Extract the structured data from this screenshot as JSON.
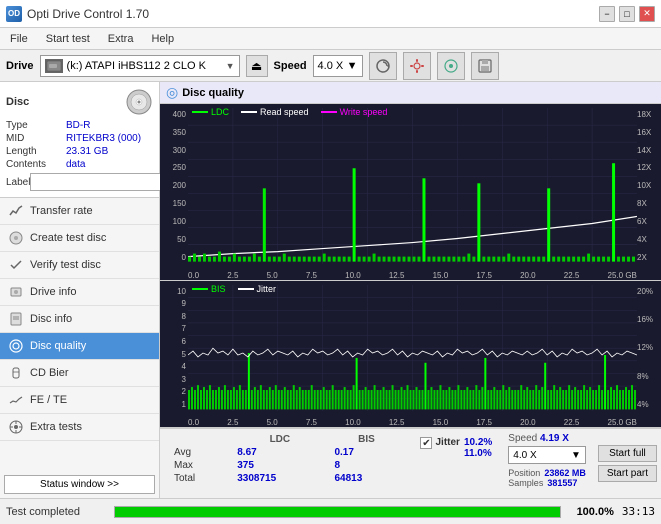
{
  "app": {
    "title": "Opti Drive Control 1.70",
    "icon": "OD"
  },
  "titlebar": {
    "minimize": "−",
    "maximize": "□",
    "close": "✕"
  },
  "menubar": {
    "items": [
      "File",
      "Start test",
      "Extra",
      "Help"
    ]
  },
  "toolbar": {
    "drive_label": "Drive",
    "drive_value": "(k:)  ATAPI iHBS112  2 CLO K",
    "speed_label": "Speed",
    "speed_value": "4.0 X"
  },
  "disc": {
    "title": "Disc",
    "type_label": "Type",
    "type_value": "BD-R",
    "mid_label": "MID",
    "mid_value": "RITEKBR3 (000)",
    "length_label": "Length",
    "length_value": "23.31 GB",
    "contents_label": "Contents",
    "contents_value": "data",
    "label_label": "Label"
  },
  "nav": {
    "items": [
      {
        "id": "transfer-rate",
        "label": "Transfer rate",
        "icon": "📈"
      },
      {
        "id": "create-test-disc",
        "label": "Create test disc",
        "icon": "💿"
      },
      {
        "id": "verify-test-disc",
        "label": "Verify test disc",
        "icon": "✔"
      },
      {
        "id": "drive-info",
        "label": "Drive info",
        "icon": "ℹ"
      },
      {
        "id": "disc-info",
        "label": "Disc info",
        "icon": "📋"
      },
      {
        "id": "disc-quality",
        "label": "Disc quality",
        "icon": "◎",
        "active": true
      },
      {
        "id": "cd-bier",
        "label": "CD Bier",
        "icon": "🍺"
      },
      {
        "id": "fe-te",
        "label": "FE / TE",
        "icon": "📉"
      },
      {
        "id": "extra-tests",
        "label": "Extra tests",
        "icon": "⚙"
      }
    ]
  },
  "status_window_btn": "Status window >>",
  "disc_quality": {
    "title": "Disc quality",
    "chart1": {
      "legend": [
        {
          "label": "LDC",
          "color": "#00ff00"
        },
        {
          "label": "Read speed",
          "color": "#ffffff"
        },
        {
          "label": "Write speed",
          "color": "#ff00ff"
        }
      ],
      "y_labels_left": [
        "400",
        "350",
        "300",
        "250",
        "200",
        "150",
        "100",
        "50",
        "0"
      ],
      "y_labels_right": [
        "18X",
        "16X",
        "14X",
        "12X",
        "10X",
        "8X",
        "6X",
        "4X",
        "2X"
      ],
      "x_labels": [
        "0.0",
        "2.5",
        "5.0",
        "7.5",
        "10.0",
        "12.5",
        "15.0",
        "17.5",
        "20.0",
        "22.5",
        "25.0 GB"
      ]
    },
    "chart2": {
      "legend": [
        {
          "label": "BIS",
          "color": "#00ff00"
        },
        {
          "label": "Jitter",
          "color": "#ffffff"
        }
      ],
      "y_labels_left": [
        "10",
        "9",
        "8",
        "7",
        "6",
        "5",
        "4",
        "3",
        "2",
        "1"
      ],
      "y_labels_right": [
        "20%",
        "16%",
        "12%",
        "8%",
        "4%"
      ],
      "x_labels": [
        "0.0",
        "2.5",
        "5.0",
        "7.5",
        "10.0",
        "12.5",
        "15.0",
        "17.5",
        "20.0",
        "22.5",
        "25.0 GB"
      ]
    }
  },
  "stats": {
    "headers": [
      "",
      "LDC",
      "BIS",
      "",
      "Jitter",
      "Speed",
      ""
    ],
    "rows": [
      {
        "label": "Avg",
        "ldc": "8.67",
        "bis": "0.17",
        "jitter": "10.2%",
        "speed_label": "Position",
        "speed_val": "23862 MB"
      },
      {
        "label": "Max",
        "ldc": "375",
        "bis": "8",
        "jitter": "11.0%",
        "speed_label": "Samples",
        "speed_val": "381557"
      },
      {
        "label": "Total",
        "ldc": "3308715",
        "bis": "64813",
        "jitter": "",
        "speed_label": "",
        "speed_val": ""
      }
    ],
    "speed_display": "4.19 X",
    "speed_select": "4.0 X",
    "jitter_checked": true,
    "jitter_label": "Jitter"
  },
  "statusbar": {
    "text": "Test completed",
    "progress": 100,
    "progress_display": "100.0%",
    "time": "33:13"
  },
  "buttons": {
    "start_full": "Start full",
    "start_part": "Start part"
  }
}
